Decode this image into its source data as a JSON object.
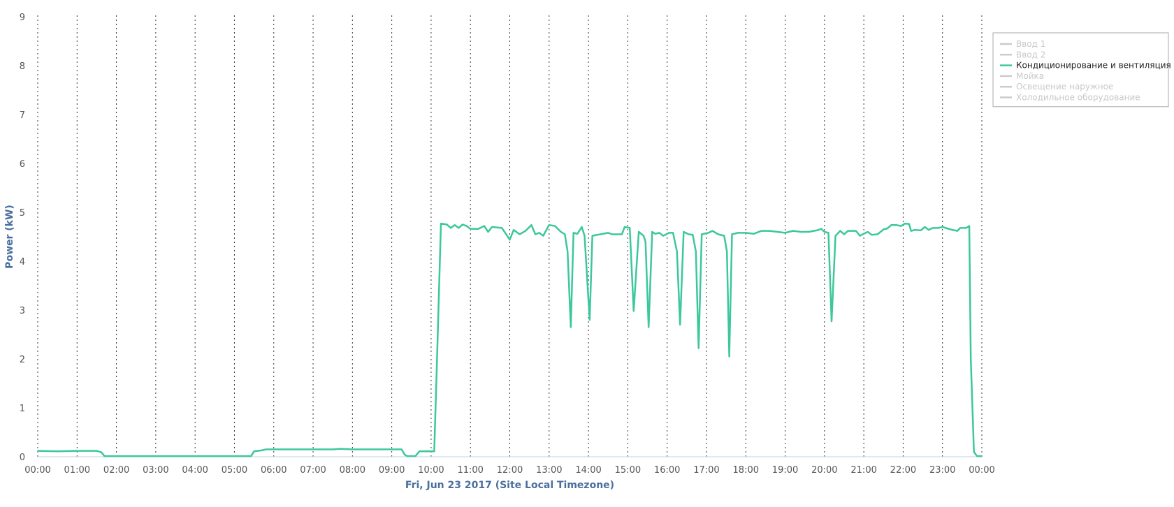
{
  "chart_data": {
    "type": "line",
    "xlabel": "Fri, Jun 23 2017 (Site Local Timezone)",
    "ylabel": "Power (kW)",
    "ylim": [
      0,
      9
    ],
    "yticks": [
      "0",
      "1",
      "2",
      "3",
      "4",
      "5",
      "6",
      "7",
      "8",
      "9"
    ],
    "xlim": [
      0,
      24
    ],
    "xticks": [
      "00:00",
      "01:00",
      "02:00",
      "03:00",
      "04:00",
      "05:00",
      "06:00",
      "07:00",
      "08:00",
      "09:00",
      "10:00",
      "11:00",
      "12:00",
      "13:00",
      "14:00",
      "15:00",
      "16:00",
      "17:00",
      "18:00",
      "19:00",
      "20:00",
      "21:00",
      "22:00",
      "23:00",
      "00:00"
    ],
    "grid": "vertical dotted lines at each hour",
    "legend_position": "top-right",
    "legend": [
      {
        "name": "Ввод 1",
        "color": "#cccccc",
        "active": false
      },
      {
        "name": "Ввод 2",
        "color": "#cccccc",
        "active": false
      },
      {
        "name": "Кондиционирование и вентиляция",
        "color": "#3cc79c",
        "active": true
      },
      {
        "name": "Мойка",
        "color": "#cccccc",
        "active": false
      },
      {
        "name": "Освещение наружное",
        "color": "#cccccc",
        "active": false
      },
      {
        "name": "Холодильное оборудование",
        "color": "#cccccc",
        "active": false
      }
    ],
    "series": [
      {
        "name": "Кондиционирование и вентиляция",
        "color": "#3cc79c",
        "x_unit": "hours",
        "points": [
          [
            0.0,
            0.12
          ],
          [
            0.5,
            0.11
          ],
          [
            1.0,
            0.12
          ],
          [
            1.5,
            0.12
          ],
          [
            1.62,
            0.09
          ],
          [
            1.7,
            0.01
          ],
          [
            2.0,
            0.01
          ],
          [
            3.0,
            0.01
          ],
          [
            4.0,
            0.01
          ],
          [
            5.0,
            0.01
          ],
          [
            5.42,
            0.01
          ],
          [
            5.5,
            0.11
          ],
          [
            5.7,
            0.13
          ],
          [
            5.8,
            0.15
          ],
          [
            6.0,
            0.15
          ],
          [
            7.0,
            0.15
          ],
          [
            7.5,
            0.15
          ],
          [
            7.7,
            0.16
          ],
          [
            8.0,
            0.15
          ],
          [
            8.5,
            0.15
          ],
          [
            9.0,
            0.15
          ],
          [
            9.25,
            0.15
          ],
          [
            9.33,
            0.04
          ],
          [
            9.4,
            0.01
          ],
          [
            9.6,
            0.01
          ],
          [
            9.7,
            0.11
          ],
          [
            9.9,
            0.11
          ],
          [
            10.08,
            0.11
          ],
          [
            10.15,
            2.0
          ],
          [
            10.25,
            4.77
          ],
          [
            10.4,
            4.75
          ],
          [
            10.5,
            4.68
          ],
          [
            10.6,
            4.74
          ],
          [
            10.7,
            4.68
          ],
          [
            10.8,
            4.75
          ],
          [
            10.9,
            4.72
          ],
          [
            11.0,
            4.66
          ],
          [
            11.2,
            4.66
          ],
          [
            11.35,
            4.72
          ],
          [
            11.45,
            4.6
          ],
          [
            11.55,
            4.7
          ],
          [
            11.8,
            4.68
          ],
          [
            11.95,
            4.5
          ],
          [
            12.0,
            4.44
          ],
          [
            12.1,
            4.64
          ],
          [
            12.25,
            4.55
          ],
          [
            12.4,
            4.62
          ],
          [
            12.55,
            4.74
          ],
          [
            12.65,
            4.55
          ],
          [
            12.75,
            4.58
          ],
          [
            12.85,
            4.52
          ],
          [
            13.0,
            4.74
          ],
          [
            13.15,
            4.72
          ],
          [
            13.3,
            4.6
          ],
          [
            13.4,
            4.55
          ],
          [
            13.47,
            4.2
          ],
          [
            13.55,
            2.65
          ],
          [
            13.62,
            4.58
          ],
          [
            13.72,
            4.56
          ],
          [
            13.83,
            4.7
          ],
          [
            13.9,
            4.52
          ],
          [
            14.03,
            2.8
          ],
          [
            14.1,
            4.52
          ],
          [
            14.3,
            4.55
          ],
          [
            14.5,
            4.58
          ],
          [
            14.6,
            4.55
          ],
          [
            14.85,
            4.55
          ],
          [
            14.92,
            4.7
          ],
          [
            15.05,
            4.68
          ],
          [
            15.15,
            2.98
          ],
          [
            15.28,
            4.6
          ],
          [
            15.4,
            4.52
          ],
          [
            15.45,
            4.4
          ],
          [
            15.53,
            2.65
          ],
          [
            15.62,
            4.6
          ],
          [
            15.7,
            4.56
          ],
          [
            15.8,
            4.58
          ],
          [
            15.9,
            4.52
          ],
          [
            16.05,
            4.58
          ],
          [
            16.15,
            4.58
          ],
          [
            16.25,
            4.2
          ],
          [
            16.33,
            2.7
          ],
          [
            16.42,
            4.6
          ],
          [
            16.55,
            4.55
          ],
          [
            16.65,
            4.54
          ],
          [
            16.73,
            4.2
          ],
          [
            16.8,
            2.22
          ],
          [
            16.88,
            4.55
          ],
          [
            17.05,
            4.58
          ],
          [
            17.15,
            4.62
          ],
          [
            17.3,
            4.55
          ],
          [
            17.45,
            4.52
          ],
          [
            17.52,
            4.2
          ],
          [
            17.58,
            2.05
          ],
          [
            17.65,
            4.55
          ],
          [
            17.8,
            4.58
          ],
          [
            18.0,
            4.58
          ],
          [
            18.2,
            4.56
          ],
          [
            18.4,
            4.62
          ],
          [
            18.6,
            4.62
          ],
          [
            18.8,
            4.6
          ],
          [
            19.0,
            4.58
          ],
          [
            19.2,
            4.62
          ],
          [
            19.4,
            4.6
          ],
          [
            19.6,
            4.6
          ],
          [
            19.8,
            4.63
          ],
          [
            19.92,
            4.66
          ],
          [
            20.0,
            4.6
          ],
          [
            20.1,
            4.58
          ],
          [
            20.18,
            2.77
          ],
          [
            20.28,
            4.52
          ],
          [
            20.4,
            4.62
          ],
          [
            20.5,
            4.55
          ],
          [
            20.6,
            4.62
          ],
          [
            20.8,
            4.62
          ],
          [
            20.9,
            4.52
          ],
          [
            21.0,
            4.56
          ],
          [
            21.1,
            4.6
          ],
          [
            21.2,
            4.54
          ],
          [
            21.35,
            4.55
          ],
          [
            21.5,
            4.65
          ],
          [
            21.6,
            4.67
          ],
          [
            21.7,
            4.74
          ],
          [
            21.82,
            4.74
          ],
          [
            21.95,
            4.72
          ],
          [
            22.05,
            4.77
          ],
          [
            22.15,
            4.76
          ],
          [
            22.2,
            4.62
          ],
          [
            22.3,
            4.64
          ],
          [
            22.45,
            4.63
          ],
          [
            22.55,
            4.7
          ],
          [
            22.65,
            4.64
          ],
          [
            22.75,
            4.68
          ],
          [
            22.9,
            4.68
          ],
          [
            23.0,
            4.7
          ],
          [
            23.2,
            4.65
          ],
          [
            23.38,
            4.62
          ],
          [
            23.45,
            4.68
          ],
          [
            23.6,
            4.68
          ],
          [
            23.68,
            4.72
          ],
          [
            23.72,
            2.0
          ],
          [
            23.8,
            0.1
          ],
          [
            23.88,
            0.01
          ],
          [
            24.0,
            0.01
          ]
        ]
      }
    ]
  }
}
